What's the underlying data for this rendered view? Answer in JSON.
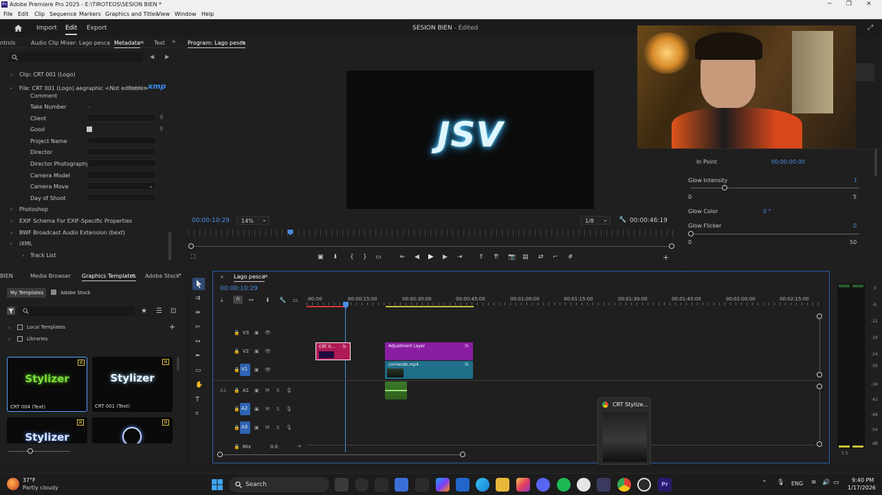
{
  "window": {
    "title": "Adobe Premiere Pro 2025 - E:\\TIROTEOS\\SESION BIEN *"
  },
  "menu": [
    "File",
    "Edit",
    "Clip",
    "Sequence",
    "Markers",
    "Graphics and Titles",
    "View",
    "Window",
    "Help"
  ],
  "appbar": {
    "tabs": [
      "Import",
      "Edit",
      "Export"
    ],
    "active": "Edit",
    "doc_title": "SESION BIEN",
    "doc_status": "- Edited"
  },
  "metadata_panel": {
    "tabs": [
      "ntrols",
      "Audio Clip Mixer: Lago pesca",
      "Metadata",
      "Text"
    ],
    "clip": "Clip: CRT 001 (Logo)",
    "file": "File: CRT 001 (Logo).aegraphic <Not editable>",
    "powered": "Powered by",
    "xmp": "xmp",
    "fields": [
      "Comment",
      "Take Number",
      "Client",
      "Good",
      "Project Name",
      "Director",
      "Director Photography",
      "Camera Model",
      "Camera Move",
      "Day of Shoot"
    ],
    "take_value": "-",
    "sections": [
      "Photoshop",
      "EXIF Schema For EXIF-Specific Properties",
      "BWF Broadcast Audio Extension (bext)",
      "iXML",
      "Track List"
    ]
  },
  "program": {
    "title": "Program: Lago pesca",
    "logo_text": "JSV",
    "timecode": "00:00:10:29",
    "zoom": "14%",
    "resolution": "1/8",
    "duration": "00:00:46:19",
    "playhead": 0.21
  },
  "effects_panel": {
    "in_point_label": "In Point",
    "in_point_value": "00:00:00:00",
    "glow_intensity_label": "Glow Intensity",
    "glow_intensity_value": "1",
    "glow_intensity_min": "0",
    "glow_intensity_max": "5",
    "glow_intensity_frac": 0.2,
    "glow_color_label": "Glow Color",
    "glow_color_value": "0 °",
    "glow_flicker_label": "Glow Flicker",
    "glow_flicker_value": "0",
    "glow_flicker_min": "0",
    "glow_flicker_max": "50",
    "glow_flicker_frac": 0.0
  },
  "templates_panel": {
    "tabs": [
      "BIEN",
      "Media Browser",
      "Graphics Templates",
      "Adobe Stock"
    ],
    "subtabs": [
      "My Templates",
      "Adobe Stock"
    ],
    "tree": [
      "Local Templates",
      "Libraries"
    ],
    "cards": [
      {
        "thumb": "Stylizer",
        "label": "CRT 004 (Text)",
        "color": "#7ee03a"
      },
      {
        "thumb": "Stylizer",
        "label": "CRT 001 (Text)",
        "color": "#e8f6ff"
      },
      {
        "thumb": "Stylizer",
        "label": "",
        "color": "#dce9ff"
      },
      {
        "thumb": "",
        "label": "",
        "color": "#c9dbff"
      }
    ]
  },
  "timeline": {
    "title": "Lago pesca",
    "timecode": "00:00:10:29",
    "ruler": [
      ":00:00",
      "00:00:15:00",
      "00:00:30:00",
      "00:00:45:00",
      "00:01:00:00",
      "00:01:15:00",
      "00:01:30:00",
      "00:01:45:00",
      "00:02:00:00",
      "00:02:15:00"
    ],
    "video_tracks": [
      "V3",
      "V2",
      "V1"
    ],
    "audio_tracks": [
      "A1",
      "A2",
      "A3"
    ],
    "mix_label": "Mix",
    "mix_value": "0.0",
    "clips": [
      {
        "label": "CRT 0...",
        "fx": "fx"
      },
      {
        "label": "Adjustment Layer",
        "fx": "fx"
      },
      {
        "label": "corriendo.mp4",
        "fx": "fx"
      }
    ]
  },
  "meter": {
    "ticks": [
      "0",
      "-6",
      "-12",
      "-18",
      "-24",
      "-30",
      "-36",
      "-42",
      "-48",
      "-54",
      "dB"
    ],
    "foot": "S  S"
  },
  "thumbnail_popup": {
    "label": "CRT Stylize..."
  },
  "taskbar": {
    "temp": "37°F",
    "weather": "Partly cloudy",
    "search": "Search",
    "lang": "ENG",
    "time": "9:40 PM",
    "date": "1/17/2026"
  }
}
